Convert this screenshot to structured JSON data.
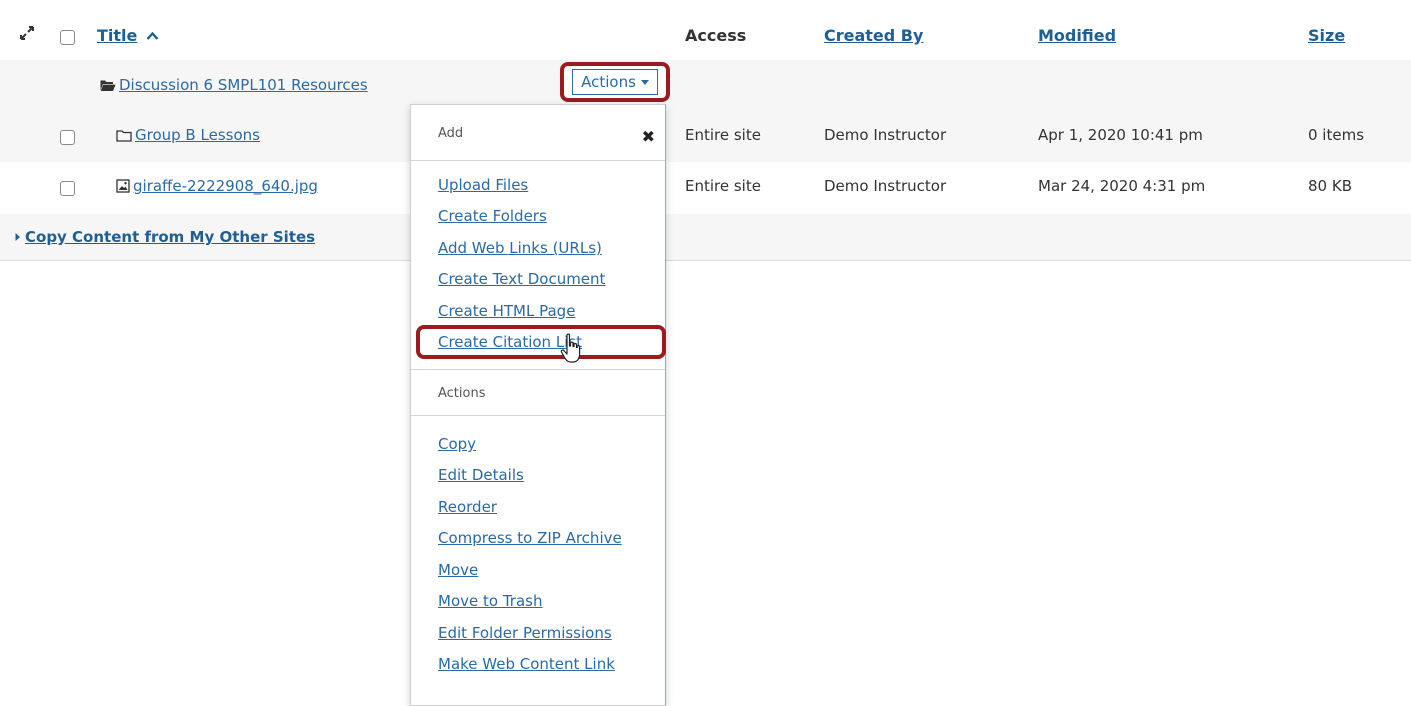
{
  "header": {
    "title_label": "Title",
    "access_label": "Access",
    "created_by_label": "Created By",
    "modified_label": "Modified",
    "size_label": "Size"
  },
  "folder_row": {
    "name": "Discussion 6 SMPL101 Resources",
    "actions_label": "Actions"
  },
  "rows": [
    {
      "name": "Group B Lessons",
      "access": "Entire site",
      "created_by": "Demo Instructor",
      "modified": "Apr 1, 2020 10:41 pm",
      "size": "0 items"
    },
    {
      "name": "giraffe-2222908_640.jpg",
      "access": "Entire site",
      "created_by": "Demo Instructor",
      "modified": "Mar 24, 2020 4:31 pm",
      "size": "80 KB"
    }
  ],
  "copy_content_label": "Copy Content from My Other Sites",
  "dropdown": {
    "add_label": "Add",
    "add_items": [
      "Upload Files",
      "Create Folders",
      "Add Web Links (URLs)",
      "Create Text Document",
      "Create HTML Page",
      "Create Citation List"
    ],
    "actions_label": "Actions",
    "action_items": [
      "Copy",
      "Edit Details",
      "Reorder",
      "Compress to ZIP Archive",
      "Move",
      "Move to Trash",
      "Edit Folder Permissions",
      "Make Web Content Link"
    ]
  },
  "colors": {
    "accent": "#2a6aa6",
    "highlight": "#9b1b1f"
  }
}
